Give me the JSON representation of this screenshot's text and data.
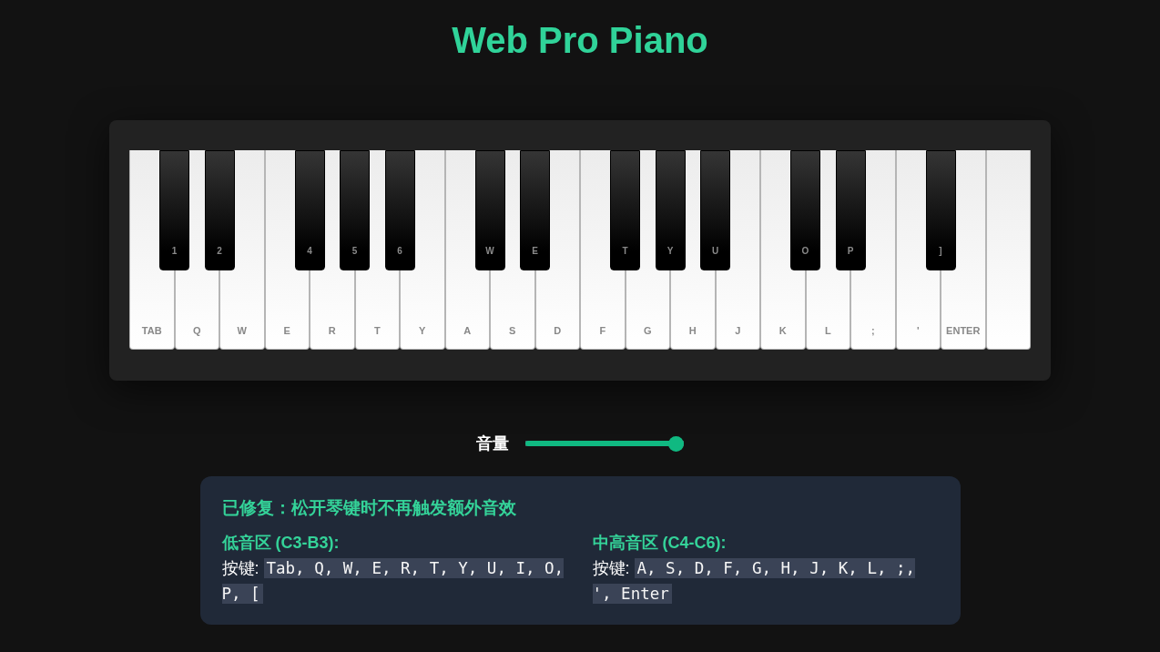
{
  "title": "Web Pro Piano",
  "piano": {
    "keys": [
      {
        "kind": "white",
        "label": "TAB"
      },
      {
        "kind": "black",
        "label": "1"
      },
      {
        "kind": "white",
        "label": "Q"
      },
      {
        "kind": "black",
        "label": "2"
      },
      {
        "kind": "white",
        "label": "W"
      },
      {
        "kind": "white",
        "label": "E"
      },
      {
        "kind": "black",
        "label": "4"
      },
      {
        "kind": "white",
        "label": "R"
      },
      {
        "kind": "black",
        "label": "5"
      },
      {
        "kind": "white",
        "label": "T"
      },
      {
        "kind": "black",
        "label": "6"
      },
      {
        "kind": "white",
        "label": "Y"
      },
      {
        "kind": "white",
        "label": "A"
      },
      {
        "kind": "black",
        "label": "W"
      },
      {
        "kind": "white",
        "label": "S"
      },
      {
        "kind": "black",
        "label": "E"
      },
      {
        "kind": "white",
        "label": "D"
      },
      {
        "kind": "white",
        "label": "F"
      },
      {
        "kind": "black",
        "label": "T"
      },
      {
        "kind": "white",
        "label": "G"
      },
      {
        "kind": "black",
        "label": "Y"
      },
      {
        "kind": "white",
        "label": "H"
      },
      {
        "kind": "black",
        "label": "U"
      },
      {
        "kind": "white",
        "label": "J"
      },
      {
        "kind": "white",
        "label": "K"
      },
      {
        "kind": "black",
        "label": "O"
      },
      {
        "kind": "white",
        "label": "L"
      },
      {
        "kind": "black",
        "label": "P"
      },
      {
        "kind": "white",
        "label": ";"
      },
      {
        "kind": "white",
        "label": "'"
      },
      {
        "kind": "black",
        "label": "]"
      },
      {
        "kind": "white",
        "label": "ENTER"
      },
      {
        "kind": "white"
      }
    ]
  },
  "volume": {
    "label": "音量",
    "level": 1
  },
  "info": {
    "heading": "已修复：松开琴键时不再触发额外音效",
    "sections": [
      {
        "title": "低音区 (C3-B3):",
        "keys_label": "按键:",
        "keys": "Tab, Q, W, E, R, T, Y, U, I, O, P, ["
      },
      {
        "title": "中高音区 (C4-C6):",
        "keys_label": "按键:",
        "keys": "A, S, D, F, G, H, J, K, L, ;, ', Enter"
      }
    ]
  }
}
